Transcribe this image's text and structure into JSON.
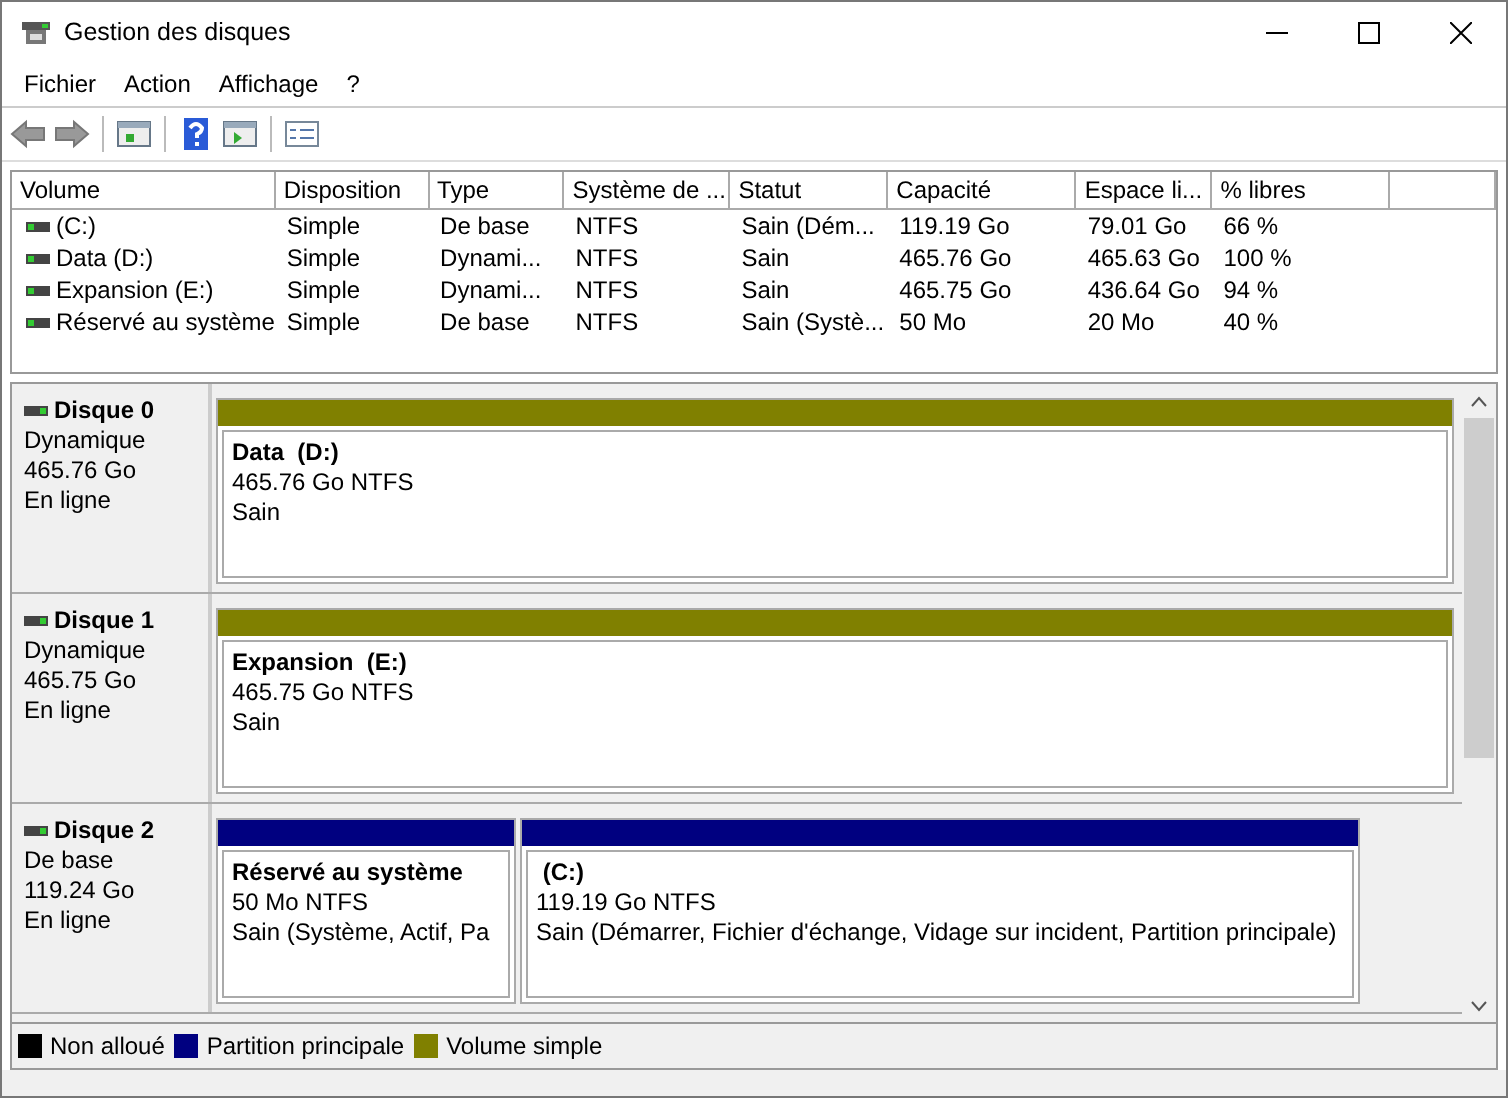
{
  "window": {
    "title": "Gestion des disques"
  },
  "menu": [
    "Fichier",
    "Action",
    "Affichage",
    "?"
  ],
  "table": {
    "columns": [
      "Volume",
      "Disposition",
      "Type",
      "Système de ...",
      "Statut",
      "Capacité",
      "Espace li...",
      "% libres"
    ],
    "rows": [
      {
        "cells": [
          "(C:)",
          "Simple",
          "De base",
          "NTFS",
          "Sain (Dém...",
          "119.19 Go",
          "79.01 Go",
          "66 %"
        ]
      },
      {
        "cells": [
          "Data (D:)",
          "Simple",
          "Dynami...",
          "NTFS",
          "Sain",
          "465.76 Go",
          "465.63 Go",
          "100 %"
        ]
      },
      {
        "cells": [
          "Expansion (E:)",
          "Simple",
          "Dynami...",
          "NTFS",
          "Sain",
          "465.75 Go",
          "436.64 Go",
          "94 %"
        ]
      },
      {
        "cells": [
          "Réservé au système",
          "Simple",
          "De base",
          "NTFS",
          "Sain (Systè...",
          "50 Mo",
          "20 Mo",
          "40 %"
        ]
      }
    ]
  },
  "disks": [
    {
      "name": "Disque 0",
      "type": "Dynamique",
      "size": "465.76 Go",
      "status": "En ligne",
      "partitions": [
        {
          "title": "Data  (D:)",
          "size": "465.76 Go NTFS",
          "status": "Sain",
          "color": "#808000"
        }
      ]
    },
    {
      "name": "Disque 1",
      "type": "Dynamique",
      "size": "465.75 Go",
      "status": "En ligne",
      "partitions": [
        {
          "title": "Expansion  (E:)",
          "size": "465.75 Go NTFS",
          "status": "Sain",
          "color": "#808000"
        }
      ]
    },
    {
      "name": "Disque 2",
      "type": "De base",
      "size": "119.24 Go",
      "status": "En ligne",
      "partitions": [
        {
          "title": "Réservé au système",
          "size": "50 Mo NTFS",
          "status": "Sain (Système, Actif, Pa",
          "color": "#000080"
        },
        {
          "title": " (C:)",
          "size": "119.19 Go NTFS",
          "status": "Sain (Démarrer, Fichier d'échange, Vidage sur incident, Partition principale)",
          "color": "#000080"
        }
      ]
    }
  ],
  "legend": [
    {
      "label": "Non alloué",
      "color": "#000000"
    },
    {
      "label": "Partition principale",
      "color": "#000080"
    },
    {
      "label": "Volume simple",
      "color": "#808000"
    }
  ]
}
